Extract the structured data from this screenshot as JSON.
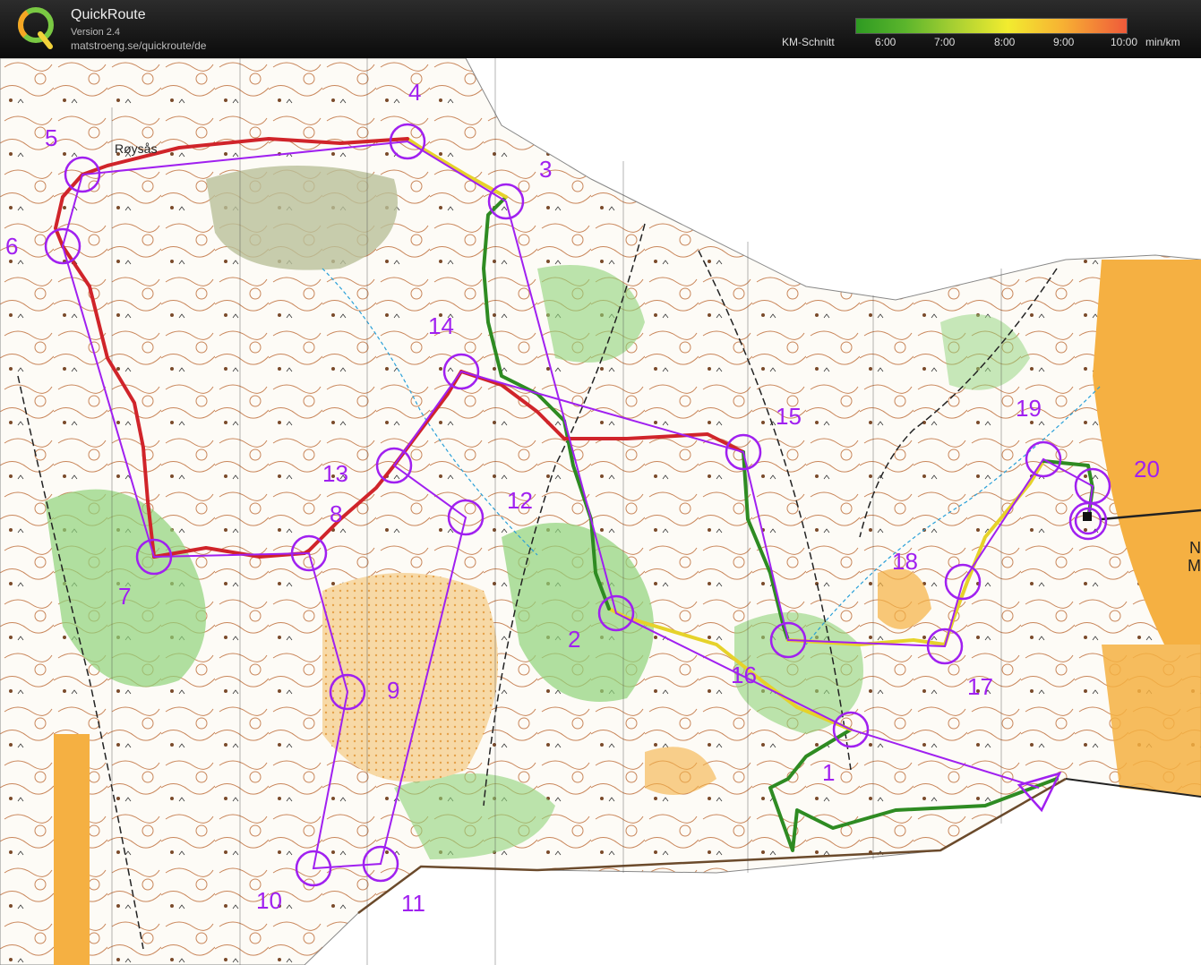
{
  "header": {
    "app_name": "QuickRoute",
    "version": "Version 2.4",
    "url": "matstroeng.se/quickroute/de",
    "logo_letter": "Q",
    "pace_scale": {
      "label": "KM-Schnitt",
      "ticks": [
        "6:00",
        "7:00",
        "8:00",
        "9:00",
        "10:00"
      ],
      "unit": "min/km"
    }
  },
  "map": {
    "place_name": "Røysås",
    "edge_text_1": "N",
    "edge_text_2": "M",
    "control_numbers": [
      "1",
      "2",
      "3",
      "4",
      "5",
      "6",
      "7",
      "8",
      "9",
      "10",
      "11",
      "12",
      "13",
      "14",
      "15",
      "16",
      "17",
      "18",
      "19",
      "20"
    ],
    "colors": {
      "course": "#a020f0",
      "route_fast": "#2e8b22",
      "route_mid": "#e6d22a",
      "route_slow": "#d0242a",
      "open_land": "#f5b042",
      "forest_green": "#5dbb4a"
    }
  }
}
